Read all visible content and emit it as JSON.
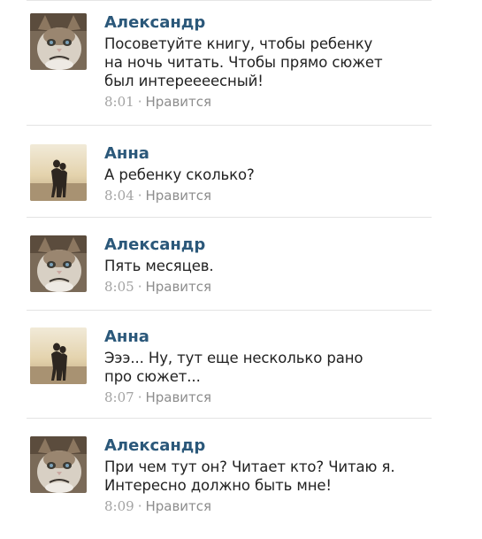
{
  "comments": [
    {
      "avatar": "grumpy-cat",
      "author": "Александр",
      "lines": [
        "Посоветуйте книгу, чтобы ребенку",
        "на ночь читать. Чтобы прямо сюжет",
        "был интереееесный!"
      ],
      "time": "8:01",
      "sep": "·",
      "like": "Нравится"
    },
    {
      "avatar": "silhouette-beach",
      "author": "Анна",
      "lines": [
        "А ребенку сколько?"
      ],
      "time": "8:04",
      "sep": "·",
      "like": "Нравится"
    },
    {
      "avatar": "grumpy-cat",
      "author": "Александр",
      "lines": [
        "Пять месяцев."
      ],
      "time": "8:05",
      "sep": "·",
      "like": "Нравится"
    },
    {
      "avatar": "silhouette-beach",
      "author": "Анна",
      "lines": [
        "Эээ... Ну, тут еще несколько рано",
        "про сюжет..."
      ],
      "time": "8:07",
      "sep": "·",
      "like": "Нравится"
    },
    {
      "avatar": "grumpy-cat",
      "author": "Александр",
      "lines": [
        "При чем тут он? Читает кто? Читаю я.",
        "Интересно должно быть мне!"
      ],
      "time": "8:09",
      "sep": "·",
      "like": "Нравится"
    }
  ]
}
